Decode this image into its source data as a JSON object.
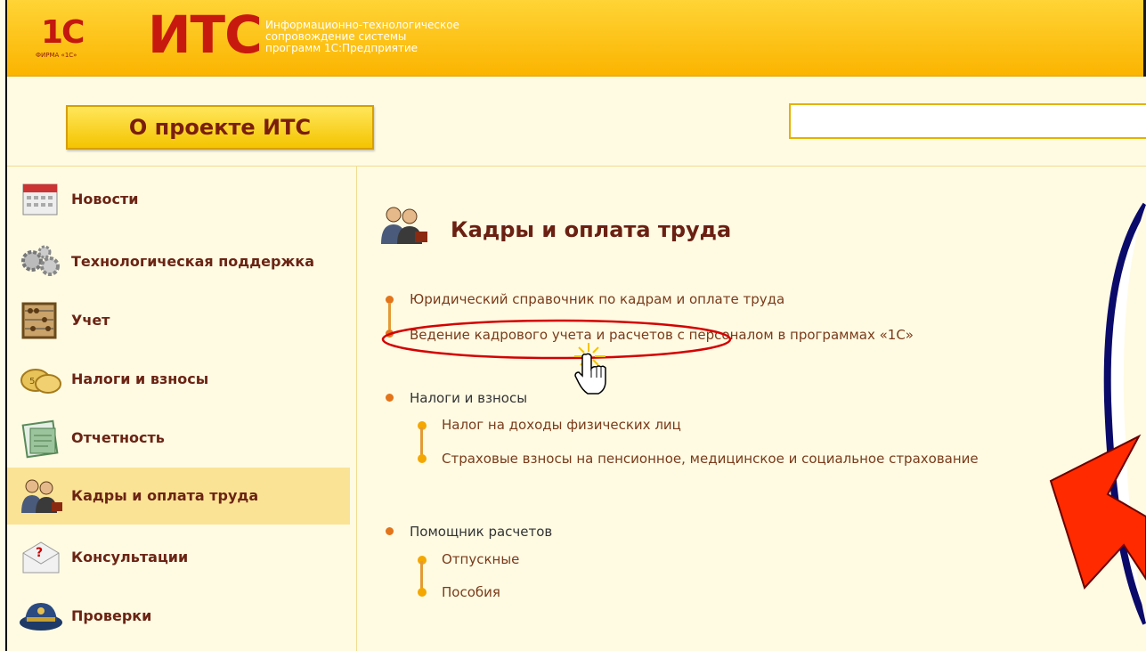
{
  "header": {
    "logo_1c_text": "1С",
    "logo_1c_firm": "ФИРМА «1С»",
    "logo_its": "ИТС",
    "tagline_1": "Информационно-технологическое",
    "tagline_2": "сопровождение системы",
    "tagline_3": "программ 1С:Предприятие"
  },
  "about_button": "О проекте ИТС",
  "search": {
    "placeholder": ""
  },
  "sidebar": {
    "items": [
      {
        "label": "Новости",
        "icon": "calendar-icon"
      },
      {
        "label": "Технологическая поддержка",
        "icon": "gears-icon"
      },
      {
        "label": "Учет",
        "icon": "abacus-icon"
      },
      {
        "label": "Налоги и взносы",
        "icon": "coins-icon"
      },
      {
        "label": "Отчетность",
        "icon": "report-folder-icon"
      },
      {
        "label": "Кадры и оплата труда",
        "icon": "people-icon",
        "active": true
      },
      {
        "label": "Консультации",
        "icon": "consult-envelope-icon"
      },
      {
        "label": "Проверки",
        "icon": "inspector-cap-icon"
      }
    ]
  },
  "main": {
    "title": "Кадры и оплата труда",
    "links_group1": [
      "Юридический справочник по кадрам и оплате труда",
      "Ведение кадрового учета и расчетов с персоналом в программах «1С»"
    ],
    "section2": {
      "heading": "Налоги и взносы",
      "links": [
        "Налог на доходы физических лиц",
        "Страховые взносы на пенсионное, медицинское и социальное страхование"
      ]
    },
    "section3": {
      "heading": "Помощник расчетов",
      "links": [
        "Отпускные",
        "Пособия"
      ]
    }
  },
  "colors": {
    "header_yellow": "#fbb400",
    "title_brown": "#6a2012",
    "highlight_oval": "#d40000",
    "arrow_red": "#ff2a00"
  }
}
